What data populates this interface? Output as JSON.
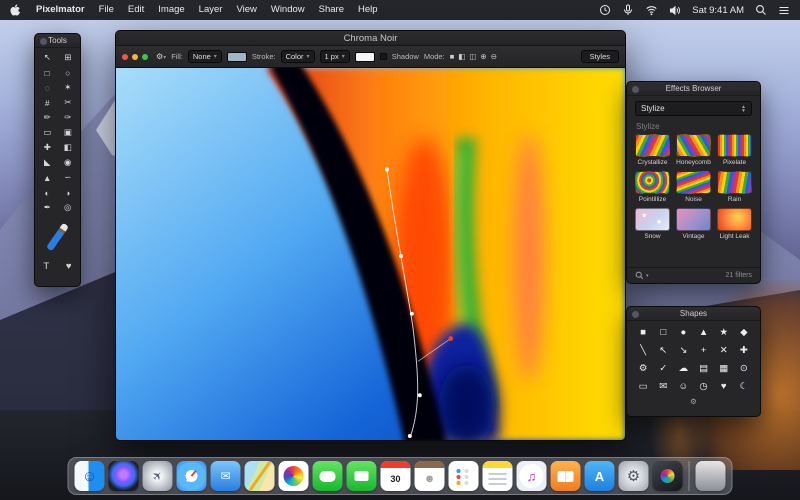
{
  "menu_bar": {
    "items": [
      "Pixelmator",
      "File",
      "Edit",
      "Image",
      "Layer",
      "View",
      "Window",
      "Share",
      "Help"
    ],
    "status": {
      "clock": "Sat 9:41 AM"
    }
  },
  "tools_panel": {
    "title": "Tools",
    "tools": [
      {
        "name": "move-tool",
        "glyph": "↖"
      },
      {
        "name": "transform-tool",
        "glyph": "⊞"
      },
      {
        "name": "rect-select-tool",
        "glyph": "□"
      },
      {
        "name": "ellipse-select-tool",
        "glyph": "○"
      },
      {
        "name": "lasso-tool",
        "glyph": "◌"
      },
      {
        "name": "magic-wand-tool",
        "glyph": "✶"
      },
      {
        "name": "crop-tool",
        "glyph": "#"
      },
      {
        "name": "slice-tool",
        "glyph": "✂"
      },
      {
        "name": "pencil-tool",
        "glyph": "✏"
      },
      {
        "name": "brush-tool",
        "glyph": "✑"
      },
      {
        "name": "eraser-tool",
        "glyph": "▭"
      },
      {
        "name": "clone-tool",
        "glyph": "▣"
      },
      {
        "name": "heal-tool",
        "glyph": "✚"
      },
      {
        "name": "gradient-tool",
        "glyph": "◧"
      },
      {
        "name": "bucket-tool",
        "glyph": "◣"
      },
      {
        "name": "blur-tool",
        "glyph": "◉"
      },
      {
        "name": "sharpen-tool",
        "glyph": "▲"
      },
      {
        "name": "smudge-tool",
        "glyph": "∽"
      },
      {
        "name": "dodge-tool",
        "glyph": "◐"
      },
      {
        "name": "burn-tool",
        "glyph": "◑"
      },
      {
        "name": "pen-tool",
        "glyph": "✒"
      },
      {
        "name": "zoom-tool",
        "glyph": "◎"
      }
    ],
    "bottom_tools": [
      {
        "name": "text-tool",
        "glyph": "T"
      },
      {
        "name": "shape-tool",
        "glyph": "♥"
      }
    ]
  },
  "window": {
    "title": "Chroma Noir",
    "toolbar": {
      "fill_label": "Fill:",
      "fill_value": "None",
      "fill_swatch_color": "#9fb6c9",
      "stroke_label": "Stroke:",
      "stroke_value": "Color",
      "stroke_width": "1 px",
      "stroke_swatch_color": "#f5f5f5",
      "shadow_label": "Shadow",
      "mode_label": "Mode:",
      "mode_icons": [
        {
          "name": "shape-union-icon",
          "glyph": "■"
        },
        {
          "name": "shape-subtract-icon",
          "glyph": "◧"
        },
        {
          "name": "shape-intersect-icon",
          "glyph": "◫"
        },
        {
          "name": "shape-exclude-icon",
          "glyph": "⊕"
        },
        {
          "name": "shape-combine-icon",
          "glyph": "⊖"
        }
      ],
      "styles_button": "Styles"
    }
  },
  "effects_browser": {
    "title": "Effects Browser",
    "category_select": "Stylize",
    "section_label": "Stylize",
    "effects": [
      {
        "name": "crystallize",
        "label": "Crystallize"
      },
      {
        "name": "honeycomb",
        "label": "Honeycomb"
      },
      {
        "name": "pixelate",
        "label": "Pixelate"
      },
      {
        "name": "pointillize",
        "label": "Pointillize"
      },
      {
        "name": "noise",
        "label": "Noise"
      },
      {
        "name": "rain",
        "label": "Rain"
      },
      {
        "name": "snow",
        "label": "Snow"
      },
      {
        "name": "vintage",
        "label": "Vintage"
      },
      {
        "name": "light-leak",
        "label": "Light Leak"
      }
    ],
    "filter_count": "21 filters"
  },
  "shapes_panel": {
    "title": "Shapes",
    "shapes": [
      {
        "name": "square",
        "glyph": "■"
      },
      {
        "name": "rounded-square",
        "glyph": "□"
      },
      {
        "name": "circle",
        "glyph": "●"
      },
      {
        "name": "triangle",
        "glyph": "▲"
      },
      {
        "name": "star",
        "glyph": "★"
      },
      {
        "name": "diamond",
        "glyph": "◆"
      },
      {
        "name": "line",
        "glyph": "╲"
      },
      {
        "name": "arrow-up-left",
        "glyph": "↖"
      },
      {
        "name": "arrow-down-right",
        "glyph": "↘"
      },
      {
        "name": "plus",
        "glyph": "+"
      },
      {
        "name": "cross",
        "glyph": "✕"
      },
      {
        "name": "badge",
        "glyph": "✚"
      },
      {
        "name": "gear",
        "glyph": "⚙"
      },
      {
        "name": "check",
        "glyph": "✓"
      },
      {
        "name": "cloud",
        "glyph": "☁"
      },
      {
        "name": "folder",
        "glyph": "▤"
      },
      {
        "name": "picture",
        "glyph": "▦"
      },
      {
        "name": "camera",
        "glyph": "⊙"
      },
      {
        "name": "display",
        "glyph": "▭"
      },
      {
        "name": "mail",
        "glyph": "✉"
      },
      {
        "name": "person",
        "glyph": "☺"
      },
      {
        "name": "clock",
        "glyph": "◷"
      },
      {
        "name": "heart",
        "glyph": "♥"
      },
      {
        "name": "moon",
        "glyph": "☾"
      }
    ]
  },
  "dock": {
    "apps": [
      {
        "name": "finder",
        "glyph": "☺"
      },
      {
        "name": "siri",
        "glyph": ""
      },
      {
        "name": "launchpad",
        "glyph": "✈"
      },
      {
        "name": "safari",
        "glyph": ""
      },
      {
        "name": "mail",
        "glyph": "✉"
      },
      {
        "name": "maps",
        "glyph": ""
      },
      {
        "name": "photos",
        "glyph": ""
      },
      {
        "name": "messages",
        "glyph": ""
      },
      {
        "name": "facetime",
        "glyph": ""
      },
      {
        "name": "calendar",
        "glyph": "30"
      },
      {
        "name": "contacts",
        "glyph": "☻"
      },
      {
        "name": "reminders",
        "glyph": ""
      },
      {
        "name": "notes",
        "glyph": ""
      },
      {
        "name": "itunes",
        "glyph": "♫"
      },
      {
        "name": "ibooks",
        "glyph": ""
      },
      {
        "name": "app-store",
        "glyph": "A"
      },
      {
        "name": "system-preferences",
        "glyph": "⚙"
      },
      {
        "name": "pixelmator",
        "glyph": ""
      }
    ]
  }
}
